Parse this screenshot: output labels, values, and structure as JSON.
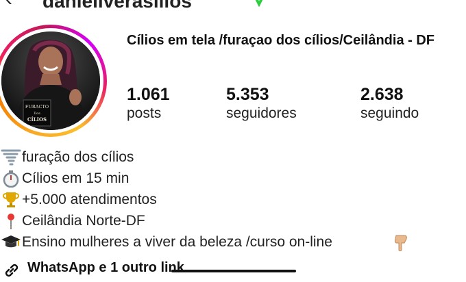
{
  "header": {
    "username": "daniellverasilios"
  },
  "profile": {
    "name": "Cílios em tela /furaçao dos cílios/Ceilândia - DF",
    "avatar_sign": {
      "line1": "FURACTO",
      "line2": "Dos",
      "line3": "CÍLIOS"
    }
  },
  "stats": [
    {
      "value": "1.061",
      "label": "posts"
    },
    {
      "value": "5.353",
      "label": "seguidores"
    },
    {
      "value": "2.638",
      "label": "seguindo"
    }
  ],
  "bio": [
    {
      "icon": "tornado-icon",
      "text": "furação dos cílios"
    },
    {
      "icon": "stopwatch-icon",
      "text": "Cílios em 15 min"
    },
    {
      "icon": "trophy-icon",
      "text": " +5.000 atendimentos"
    },
    {
      "icon": "pin-icon",
      "text": "Ceilândia Norte-DF"
    },
    {
      "icon": "graduation-cap-icon",
      "text": "Ensino mulheres a viver da beleza /curso on-line"
    }
  ],
  "link": {
    "icon": "link-icon",
    "text": "WhatsApp e 1 outro link"
  },
  "colors": {
    "ring_start": "#f9a825",
    "ring_mid": "#e91e63",
    "ring_end": "#d500f9",
    "text": "#111111",
    "verified_green": "#2ecc40"
  }
}
